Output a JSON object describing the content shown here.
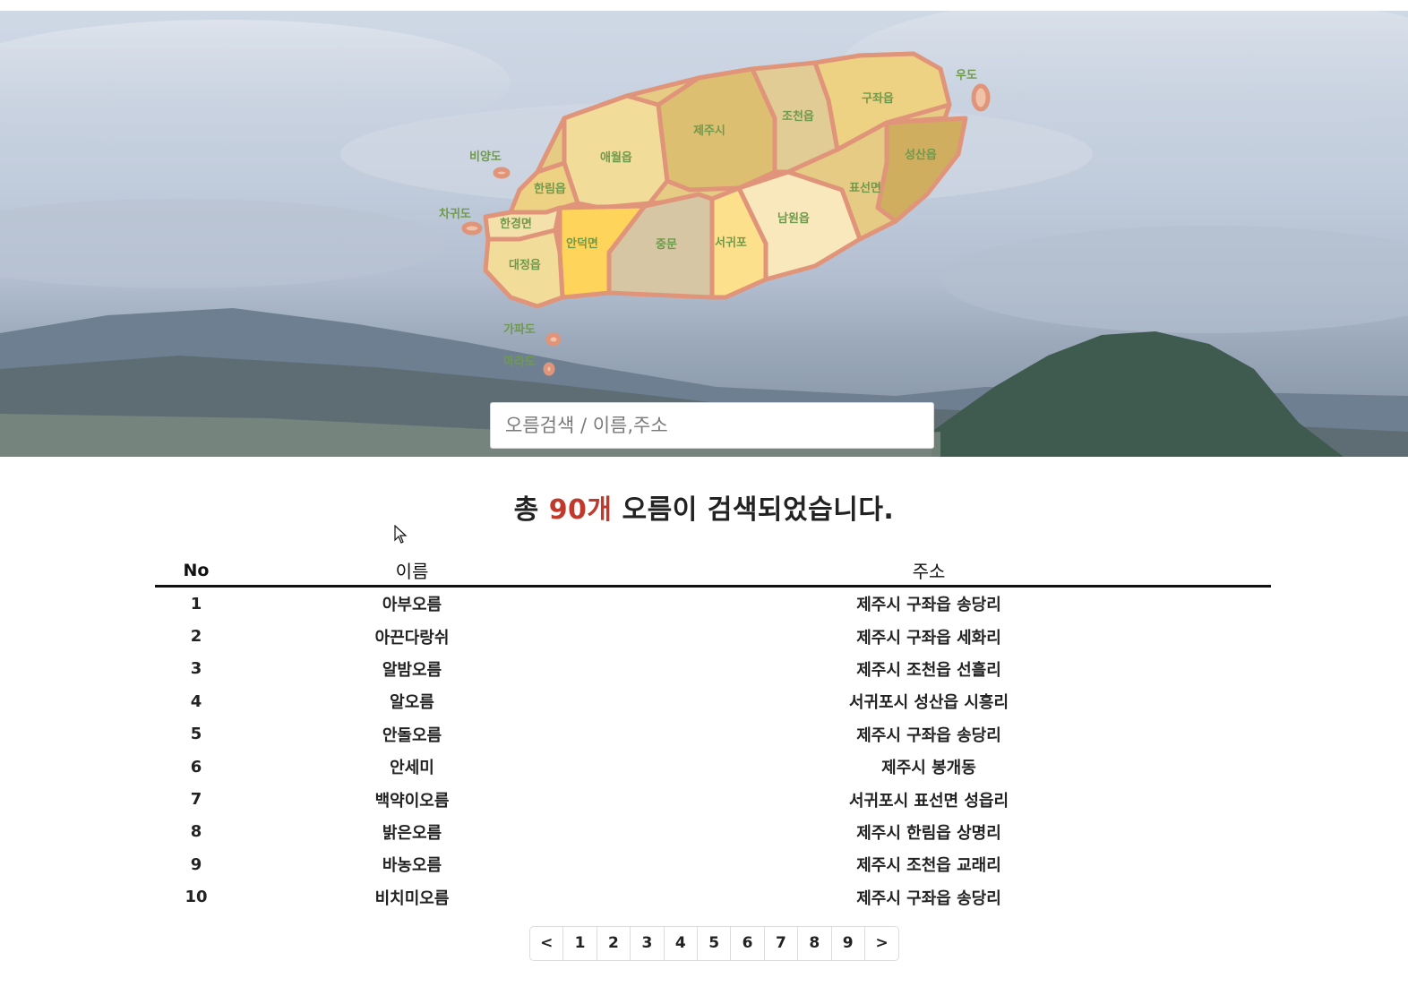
{
  "map": {
    "labels": [
      "우도",
      "구좌읍",
      "조천읍",
      "제주시",
      "애월읍",
      "성산읍",
      "비양도",
      "한림읍",
      "표선면",
      "남원읍",
      "차귀도",
      "한경면",
      "안덕면",
      "중문",
      "서귀포",
      "대정읍",
      "가파도",
      "마라도"
    ]
  },
  "search": {
    "placeholder": "오름검색 / 이름,주소",
    "value": ""
  },
  "summary": {
    "prefix": "총 ",
    "count": "90개",
    "suffix": " 오름이 검색되었습니다."
  },
  "table": {
    "headers": {
      "no": "No",
      "name": "이름",
      "address": "주소"
    },
    "rows": [
      {
        "no": "1",
        "name": "아부오름",
        "address": "제주시 구좌읍 송당리"
      },
      {
        "no": "2",
        "name": "아끈다랑쉬",
        "address": "제주시 구좌읍 세화리"
      },
      {
        "no": "3",
        "name": "알밤오름",
        "address": "제주시 조천읍 선흘리"
      },
      {
        "no": "4",
        "name": "알오름",
        "address": "서귀포시 성산읍 시흥리"
      },
      {
        "no": "5",
        "name": "안돌오름",
        "address": "제주시 구좌읍 송당리"
      },
      {
        "no": "6",
        "name": "안세미",
        "address": "제주시 봉개동"
      },
      {
        "no": "7",
        "name": "백약이오름",
        "address": "서귀포시 표선면 성읍리"
      },
      {
        "no": "8",
        "name": "밝은오름",
        "address": "제주시 한림읍 상명리"
      },
      {
        "no": "9",
        "name": "바농오름",
        "address": "제주시 조천읍 교래리"
      },
      {
        "no": "10",
        "name": "비치미오름",
        "address": "제주시 구좌읍 송당리"
      }
    ]
  },
  "pagination": {
    "prev": "<",
    "pages": [
      "1",
      "2",
      "3",
      "4",
      "5",
      "6",
      "7",
      "8",
      "9"
    ],
    "next": ">"
  },
  "colors": {
    "accent": "#c0392b",
    "map_border": "#e0957a"
  }
}
